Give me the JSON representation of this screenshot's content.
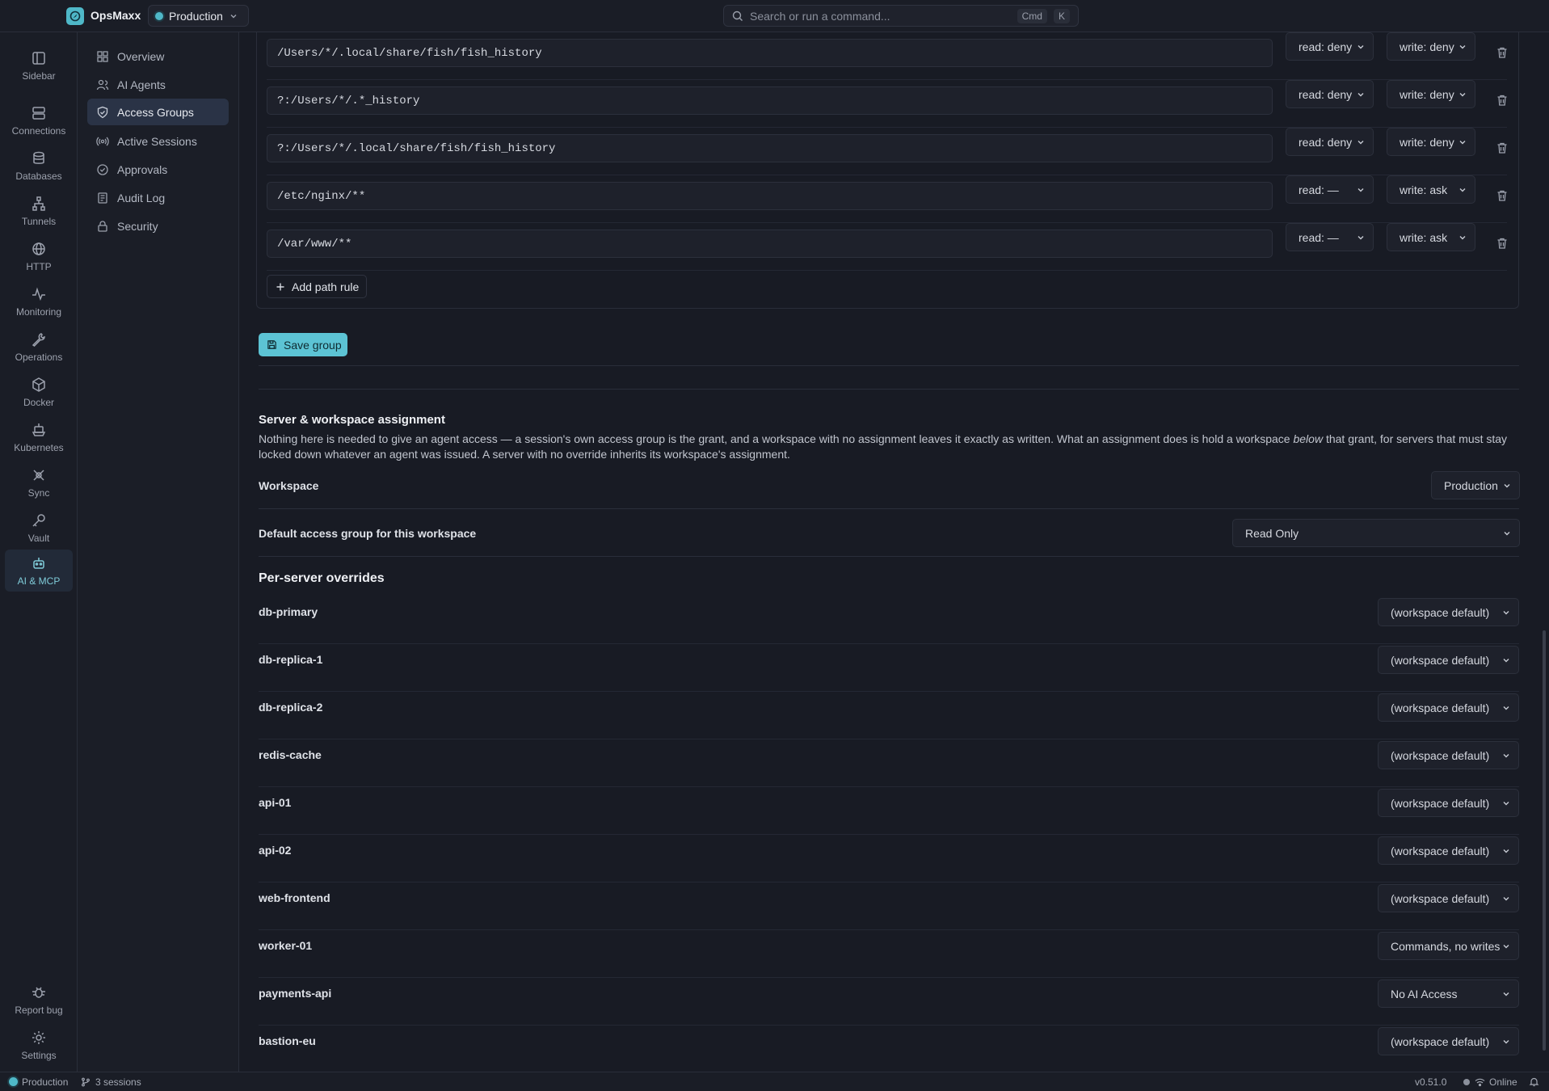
{
  "app": {
    "name": "OpsMaxx",
    "workspace": "Production"
  },
  "search": {
    "placeholder": "Search or run a command...",
    "key1": "Cmd",
    "key2": "K"
  },
  "rail": [
    {
      "label": "Sidebar",
      "icon": "sidebar-icon"
    },
    {
      "label": "Connections",
      "icon": "server-icon"
    },
    {
      "label": "Databases",
      "icon": "database-icon"
    },
    {
      "label": "Tunnels",
      "icon": "network-icon"
    },
    {
      "label": "HTTP",
      "icon": "globe-icon"
    },
    {
      "label": "Monitoring",
      "icon": "activity-icon"
    },
    {
      "label": "Operations",
      "icon": "wrench-icon"
    },
    {
      "label": "Docker",
      "icon": "box-icon"
    },
    {
      "label": "Kubernetes",
      "icon": "ship-icon"
    },
    {
      "label": "Sync",
      "icon": "sync-icon"
    },
    {
      "label": "Vault",
      "icon": "key-icon"
    },
    {
      "label": "AI & MCP",
      "icon": "robot-icon",
      "active": true
    },
    {
      "label": "Report bug",
      "icon": "bug-icon"
    },
    {
      "label": "Settings",
      "icon": "gear-icon"
    }
  ],
  "subnav": [
    {
      "label": "Overview",
      "icon": "grid-icon"
    },
    {
      "label": "AI Agents",
      "icon": "users-icon"
    },
    {
      "label": "Access Groups",
      "icon": "shield-icon",
      "active": true
    },
    {
      "label": "Active Sessions",
      "icon": "radio-icon"
    },
    {
      "label": "Approvals",
      "icon": "check-circle-icon"
    },
    {
      "label": "Audit Log",
      "icon": "log-icon"
    },
    {
      "label": "Security",
      "icon": "lock-icon"
    }
  ],
  "path_rules": [
    {
      "path": "/Users/*/.local/share/fish/fish_history",
      "read": "read: deny",
      "write": "write: deny"
    },
    {
      "path": "?:/Users/*/.*_history",
      "read": "read: deny",
      "write": "write: deny"
    },
    {
      "path": "?:/Users/*/.local/share/fish/fish_history",
      "read": "read: deny",
      "write": "write: deny"
    },
    {
      "path": "/etc/nginx/**",
      "read": "read: —",
      "write": "write: ask"
    },
    {
      "path": "/var/www/**",
      "read": "read: —",
      "write": "write: ask"
    }
  ],
  "add_path_rule": "Add path rule",
  "save_group": "Save group",
  "assignment": {
    "title": "Server & workspace assignment",
    "desc_1": "Nothing here is needed to give an agent access — a session's own access group is the grant, and a workspace with no assignment leaves it exactly as written. What an assignment does is hold a workspace ",
    "desc_em": "below",
    "desc_2": " that grant, for servers that must stay locked down whatever an agent was issued. A server with no override inherits its workspace's assignment.",
    "workspace_label": "Workspace",
    "workspace_value": "Production",
    "default_label": "Default access group for this workspace",
    "default_value": "Read Only"
  },
  "overrides": {
    "title": "Per-server overrides",
    "servers": [
      {
        "name": "db-primary",
        "value": "(workspace default)"
      },
      {
        "name": "db-replica-1",
        "value": "(workspace default)"
      },
      {
        "name": "db-replica-2",
        "value": "(workspace default)"
      },
      {
        "name": "redis-cache",
        "value": "(workspace default)"
      },
      {
        "name": "api-01",
        "value": "(workspace default)"
      },
      {
        "name": "api-02",
        "value": "(workspace default)"
      },
      {
        "name": "web-frontend",
        "value": "(workspace default)"
      },
      {
        "name": "worker-01",
        "value": "Commands, no writes"
      },
      {
        "name": "payments-api",
        "value": "No AI Access"
      },
      {
        "name": "bastion-eu",
        "value": "(workspace default)"
      }
    ]
  },
  "status": {
    "workspace": "Production",
    "sessions": "3 sessions",
    "version": "v0.51.0",
    "online": "Online"
  },
  "colors": {
    "accent": "#5cc3d4",
    "background": "#181b24",
    "panel": "#1a1d26"
  }
}
